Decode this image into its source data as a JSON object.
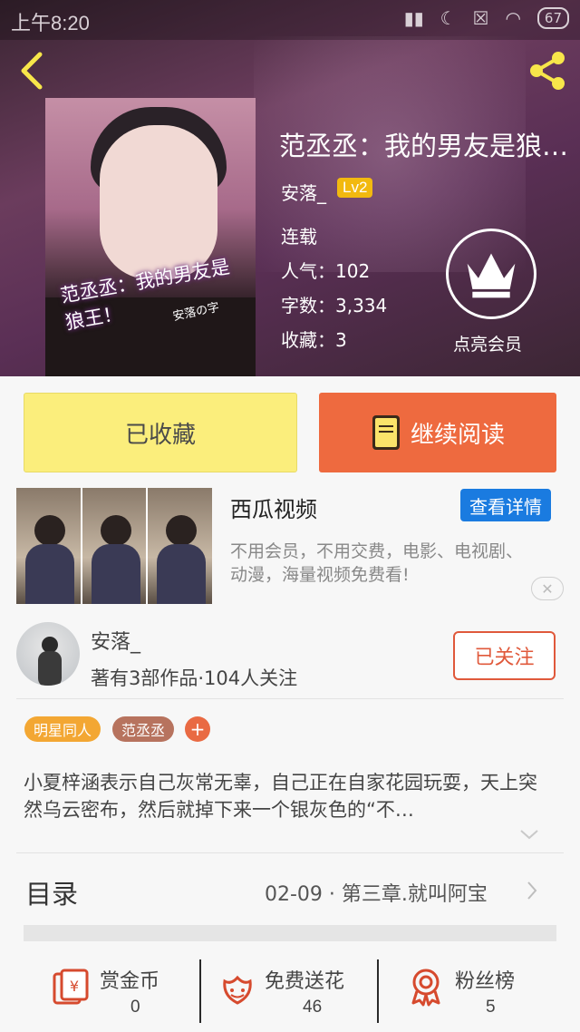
{
  "status_bar": {
    "time": "上午8:20",
    "battery": "67"
  },
  "book": {
    "title": "范丞丞：我的男友是狼…",
    "author": "安落_",
    "level": "Lv2",
    "status": "连载",
    "popularity": "人气：102",
    "word_count": "字数：3,334",
    "favorites": "收藏：3",
    "cover_title": "范丞丞：我的男友是狼王！",
    "cover_author": "安落の字"
  },
  "vip": {
    "label": "点亮会员"
  },
  "actions": {
    "collected_label": "已收藏",
    "read_label": "继续阅读"
  },
  "ad": {
    "title": "西瓜视频",
    "detail_label": "查看详情",
    "description": "不用会员，不用交费，电影、电视剧、动漫，海量视频免费看!",
    "close": "✕"
  },
  "writer": {
    "name": "安落_",
    "stats": "著有3部作品·104人关注",
    "follow_label": "已关注"
  },
  "tags": [
    {
      "label": "明星同人",
      "color": "#f3a733"
    },
    {
      "label": "范丞丞",
      "color": "#b7735e"
    }
  ],
  "tag_add": "+",
  "synopsis": "小夏梓涵表示自己灰常无辜，自己正在自家花园玩耍，天上突然乌云密布，然后就掉下来一个银灰色的“不…",
  "toc": {
    "label": "目录",
    "latest": "02-09 · 第三章.就叫阿宝"
  },
  "bottom_stats": [
    {
      "label": "赏金币",
      "value": "0",
      "icon": "red-envelope-icon"
    },
    {
      "label": "免费送花",
      "value": "46",
      "icon": "flower-icon"
    },
    {
      "label": "粉丝榜",
      "value": "5",
      "icon": "medal-icon"
    }
  ],
  "colors": {
    "accent_orange": "#ee6a3f",
    "collected_yellow": "#fbee7c",
    "link_blue": "#1a7be0",
    "icon_red": "#d64a2e"
  }
}
